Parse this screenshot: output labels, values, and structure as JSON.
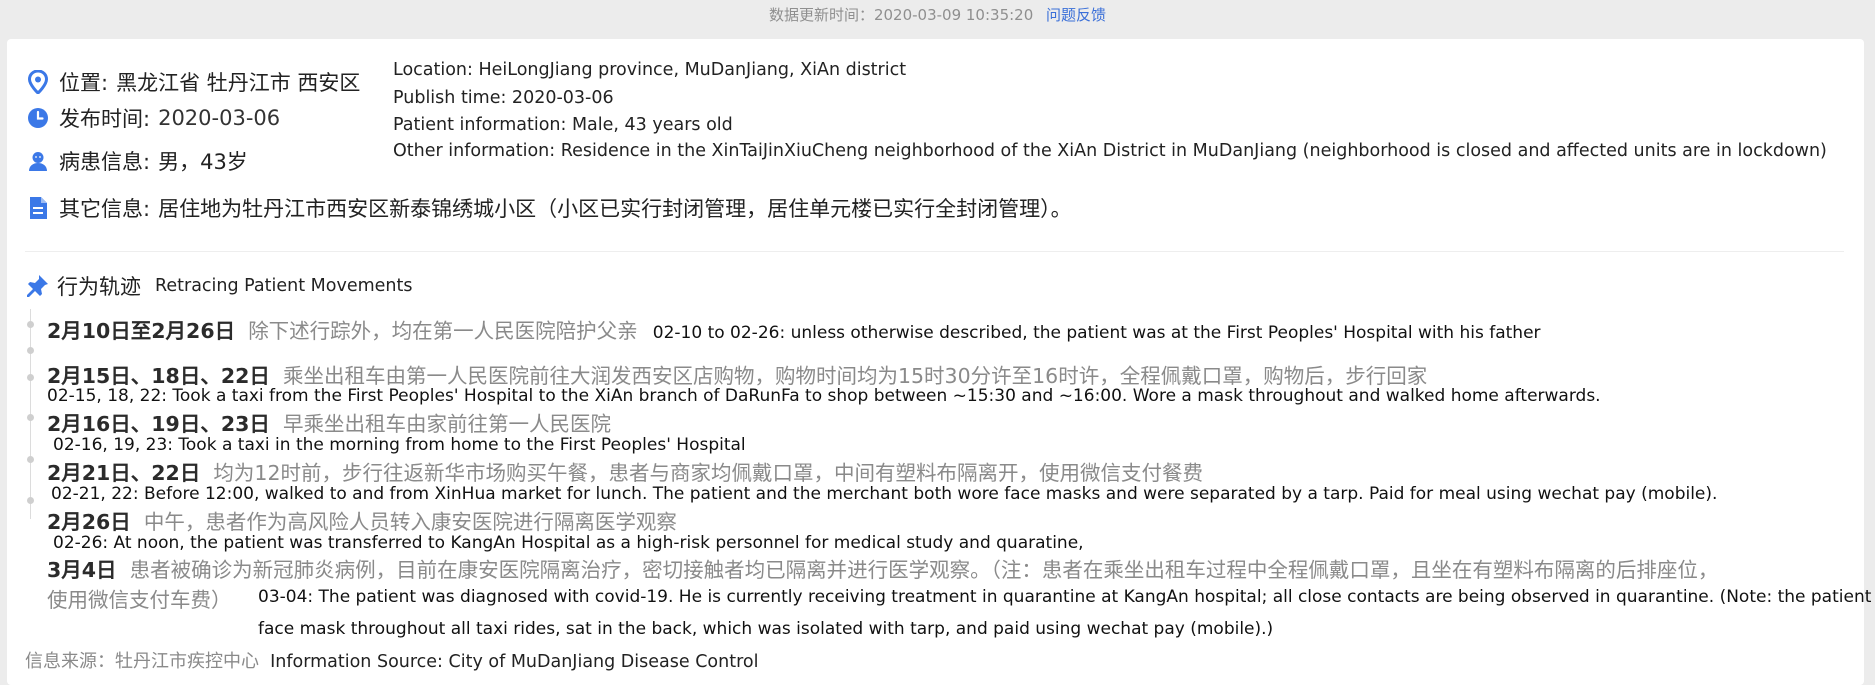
{
  "header": {
    "update_time": "数据更新时间：2020-03-09 10:35:20",
    "feedback_link": "问题反馈"
  },
  "info": {
    "location_label": "位置:",
    "location_value": "黑龙江省 牡丹江市 西安区",
    "publish_label": "发布时间:",
    "publish_value": "2020-03-06",
    "patient_label": "病患信息:",
    "patient_value": "男，43岁",
    "other_label": "其它信息:",
    "other_value": "居住地为牡丹江市西安区新泰锦绣城小区（小区已实行封闭管理，居住单元楼已实行全封闭管理）。"
  },
  "info_en": {
    "location": "Location: HeiLongJiang province, MuDanJiang, XiAn district",
    "publish": "Publish time: 2020-03-06",
    "patient": "Patient information: Male, 43 years old",
    "other": "Other information: Residence in the XinTaiJinXiuCheng neighborhood of the XiAn District in MuDanJiang (neighborhood is closed and affected units are in lockdown)"
  },
  "movements": {
    "title_zh": "行为轨迹",
    "title_en": "Retracing Patient Movements",
    "entries": [
      {
        "date": "2月10日至2月26日",
        "desc_zh": "除下述行踪外，均在第一人民医院陪护父亲",
        "desc_en": "02-10 to 02-26: unless otherwise described, the patient was at the First Peoples' Hospital with his father"
      },
      {
        "date": "2月15日、18日、22日",
        "desc_zh": "乘坐出租车由第一人民医院前往大润发西安区店购物，购物时间均为15时30分许至16时许，全程佩戴口罩，购物后，步行回家",
        "desc_en": "02-15, 18, 22: Took a taxi from the First Peoples' Hospital to the XiAn branch of DaRunFa to shop between ~15:30 and ~16:00.  Wore a mask throughout and walked home afterwards."
      },
      {
        "date": "2月16日、19日、23日",
        "desc_zh": "早乘坐出租车由家前往第一人民医院",
        "desc_en": "02-16, 19, 23: Took a taxi in the morning from home to the First Peoples' Hospital"
      },
      {
        "date": "2月21日、22日",
        "desc_zh": "均为12时前，步行往返新华市场购买午餐，患者与商家均佩戴口罩，中间有塑料布隔离开，使用微信支付餐费",
        "desc_en": "02-21, 22: Before 12:00, walked to and from XinHua market for lunch. The patient and the merchant both wore face masks and were separated by a tarp. Paid for meal using wechat pay (mobile)."
      },
      {
        "date": "2月26日",
        "desc_zh": "中午，患者作为高风险人员转入康安医院进行隔离医学观察",
        "desc_en": "02-26: At noon, the patient was transferred to KangAn Hospital as a high-risk personnel for medical study and quaratine,"
      },
      {
        "date": "3月4日",
        "desc_zh_line1": "患者被确诊为新冠肺炎病例，目前在康安医院隔离治疗，密切接触者均已隔离并进行医学观察。（注：患者在乘坐出租车过程中全程佩戴口罩，且坐在有塑料布隔离的后排座位，",
        "desc_zh_line2": "使用微信支付车费）",
        "desc_en_line1": "03-04: The patient was diagnosed with covid-19. He is currently receiving treatment in quarantine at KangAn hospital; all close contacts are being observed in quarantine. (Note: the patient wore a",
        "desc_en_line2": "face mask throughout all taxi rides, sat in the back, which was isolated with tarp, and paid using wechat pay (mobile).)"
      }
    ]
  },
  "source": {
    "zh": "信息来源：牡丹江市疾控中心",
    "en": "Information Source: City of MuDanJiang Disease Control"
  },
  "colors": {
    "accent": "#3a6fd8",
    "icon": "#3b78e7",
    "muted": "#8a8a8a"
  }
}
